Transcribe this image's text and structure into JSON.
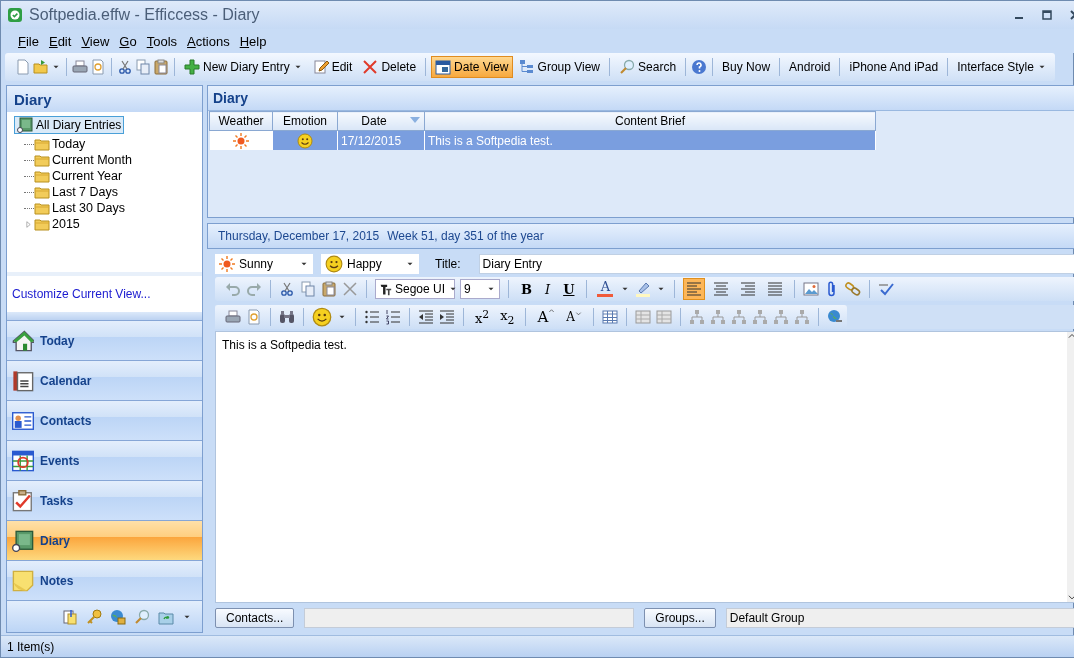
{
  "window": {
    "title": "Softpedia.effw - Efficcess - Diary"
  },
  "menu": [
    {
      "label": "File"
    },
    {
      "label": "Edit"
    },
    {
      "label": "View"
    },
    {
      "label": "Go"
    },
    {
      "label": "Tools"
    },
    {
      "label": "Actions"
    },
    {
      "label": "Help"
    }
  ],
  "toolbar": [
    {
      "label": "New Diary Entry",
      "dropdown": true,
      "selected": false
    },
    {
      "label": "Edit",
      "dropdown": false,
      "selected": false
    },
    {
      "label": "Delete",
      "dropdown": false,
      "selected": false
    },
    {
      "label": "Date View",
      "dropdown": false,
      "selected": true
    },
    {
      "label": "Group View",
      "dropdown": false,
      "selected": false
    },
    {
      "label": "Search",
      "dropdown": false,
      "selected": false
    },
    {
      "label": "Buy Now",
      "dropdown": false,
      "selected": false
    },
    {
      "label": "Android",
      "dropdown": false,
      "selected": false
    },
    {
      "label": "iPhone And iPad",
      "dropdown": false,
      "selected": false
    },
    {
      "label": "Interface Style",
      "dropdown": true,
      "selected": false
    }
  ],
  "sidebar": {
    "title": "Diary",
    "tree": {
      "label": "All Diary Entries",
      "selected": true,
      "children": [
        {
          "label": "Today",
          "kind": "leaf",
          "selected": false
        },
        {
          "label": "Current Month",
          "kind": "leaf",
          "selected": false
        },
        {
          "label": "Current Year",
          "kind": "leaf",
          "selected": false
        },
        {
          "label": "Last 7 Days",
          "kind": "leaf",
          "selected": false
        },
        {
          "label": "Last 30 Days",
          "kind": "leaf",
          "selected": false
        },
        {
          "label": "2015",
          "kind": "group",
          "selected": false
        }
      ]
    },
    "link": "Customize Current View...",
    "nav": [
      {
        "label": "Today",
        "selected": false
      },
      {
        "label": "Calendar",
        "selected": false
      },
      {
        "label": "Contacts",
        "selected": false
      },
      {
        "label": "Events",
        "selected": false
      },
      {
        "label": "Tasks",
        "selected": false
      },
      {
        "label": "Diary",
        "selected": true
      },
      {
        "label": "Notes",
        "selected": false
      }
    ]
  },
  "list": {
    "title": "Diary",
    "columns": [
      {
        "label": "Weather",
        "sorted": false
      },
      {
        "label": "Emotion",
        "sorted": false
      },
      {
        "label": "Date",
        "sorted": true
      },
      {
        "label": "Content Brief",
        "sorted": false
      }
    ],
    "rows": [
      {
        "date": "17/12/2015",
        "brief": "This is a Softpedia test.",
        "selected": true
      }
    ]
  },
  "editor": {
    "date": "Thursday, December 17, 2015",
    "week": "Week 51, day 351 of the year",
    "weather": "Sunny",
    "emotion": "Happy",
    "title_label": "Title:",
    "title": "Diary Entry",
    "font": "Segoe UI",
    "size": "9",
    "format_buttons": [
      "B",
      "I",
      "U"
    ],
    "font_color_label": "A",
    "align": [
      {
        "selected": true
      },
      {
        "selected": false
      },
      {
        "selected": false
      },
      {
        "selected": false
      }
    ],
    "script_buttons": [
      "x$^{2}$",
      "x$_{2}$"
    ],
    "size_buttons": [
      "A",
      "A"
    ],
    "body": "This is a Softpedia test.",
    "contacts_button": "Contacts...",
    "groups_button": "Groups...",
    "group": "Default Group"
  },
  "status_bar": {
    "text": "1 Item(s)"
  }
}
